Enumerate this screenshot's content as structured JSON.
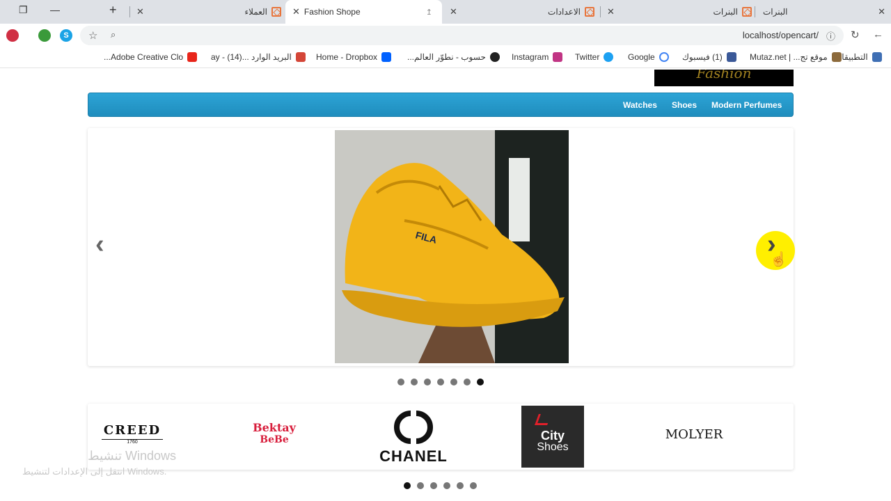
{
  "tabs": [
    {
      "title": "البنرات",
      "active": false
    },
    {
      "title": "الاعدادات",
      "active": false
    },
    {
      "title": "Fashion Shope",
      "active": true
    },
    {
      "title": "العملاء",
      "active": false
    }
  ],
  "toolbar": {
    "url": "localhost/opencart/"
  },
  "bookmarks": [
    {
      "label": "التطبيقات",
      "icon": "apps-icon"
    },
    {
      "label": "موقع تج... | Mutaz.net",
      "icon": "site-icon"
    },
    {
      "label": "(1) فيسبوك",
      "icon": "facebook-icon"
    },
    {
      "label": "Google",
      "icon": "google-icon"
    },
    {
      "label": "Twitter",
      "icon": "twitter-icon"
    },
    {
      "label": "Instagram",
      "icon": "instagram-icon"
    },
    {
      "label": "حسوب - نطوّر العالم...",
      "icon": "hsoub-icon"
    },
    {
      "label": "Home - Dropbox",
      "icon": "dropbox-icon"
    },
    {
      "label": "البريد الوارد ...ay - (14)",
      "icon": "gmail-icon"
    },
    {
      "label": "Adobe Creative Clo...",
      "icon": "adobe-icon"
    }
  ],
  "store": {
    "logo_text": "Fashion",
    "nav": [
      "Modern Perfumes",
      "Shoes",
      "Watches"
    ]
  },
  "slider": {
    "slide_count": 7,
    "active_slide": 7
  },
  "brands": {
    "items": [
      "CREED",
      "1760",
      "Bektay",
      "BeBe",
      "CHANEL",
      "City",
      "Shoes",
      "MOLYER"
    ],
    "page_count": 6,
    "active_page": 1
  },
  "watermark": {
    "line1": "تنشيط Windows",
    "line2": "انتقل إلى الإعدادات لتنشيط Windows."
  },
  "colors": {
    "nav_bg": "#2da4d6",
    "cursor_highlight": "#ffef00",
    "shoe": "#f2b418"
  }
}
